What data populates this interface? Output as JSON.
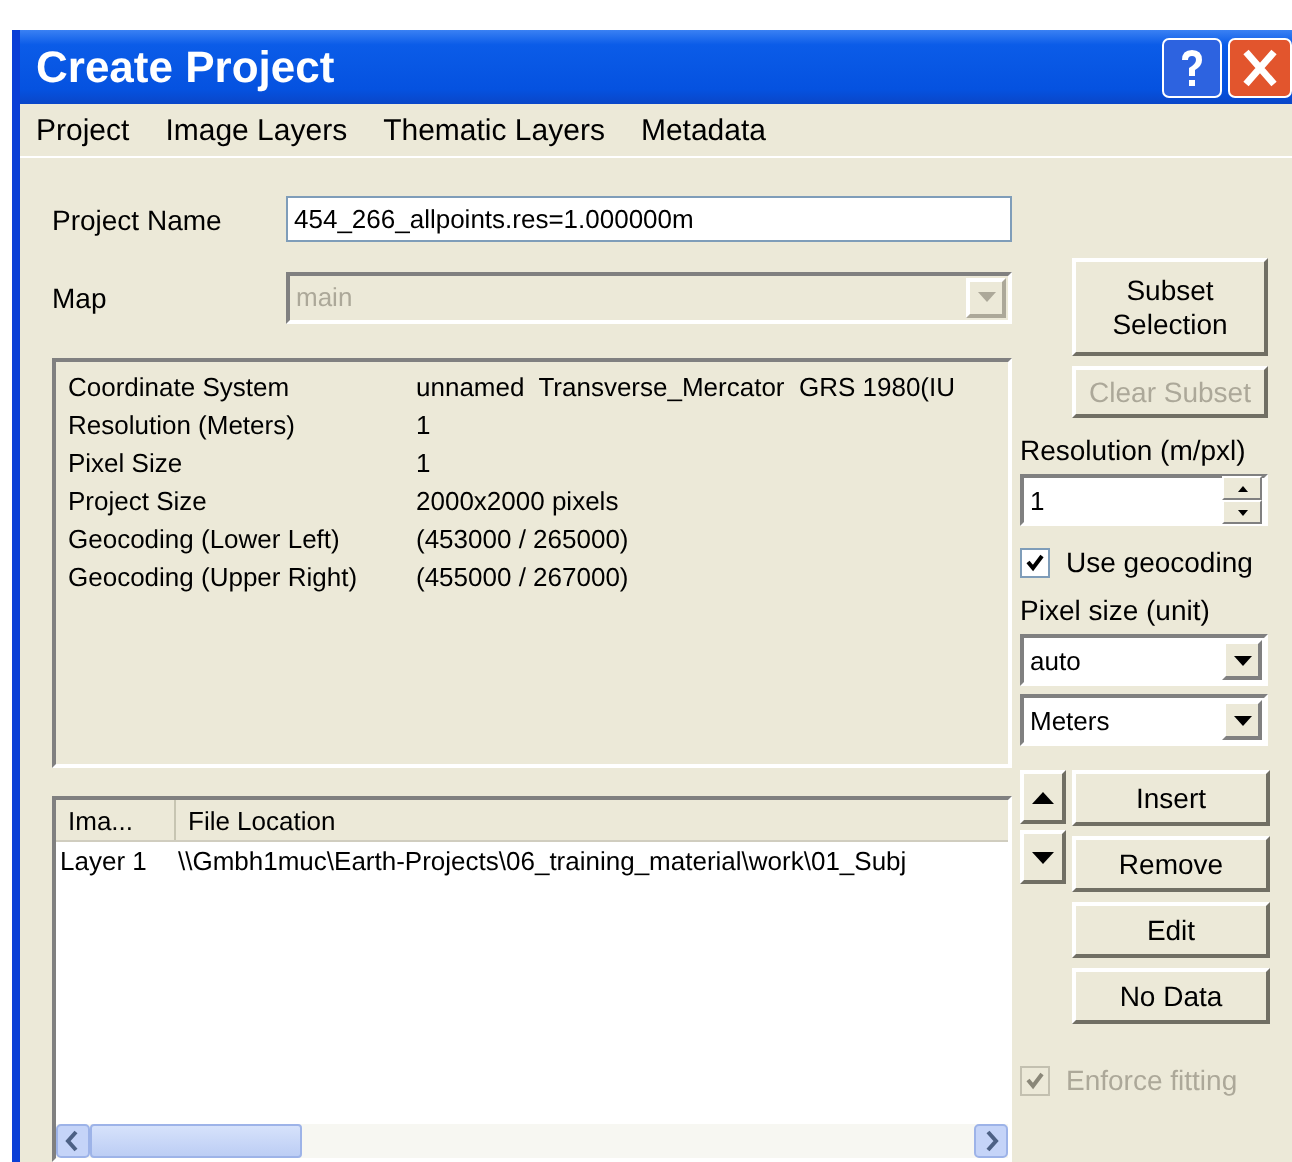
{
  "window": {
    "title": "Create Project"
  },
  "menu": [
    "Project",
    "Image Layers",
    "Thematic Layers",
    "Metadata"
  ],
  "project_name": {
    "label": "Project Name",
    "value": "454_266_allpoints.res=1.000000m"
  },
  "map": {
    "label": "Map",
    "value": "main",
    "disabled": true
  },
  "info": [
    {
      "label": "Coordinate System",
      "value": "unnamed  Transverse_Mercator  GRS 1980(IU"
    },
    {
      "label": "Resolution (Meters)",
      "value": "1"
    },
    {
      "label": "Pixel Size",
      "value": "1"
    },
    {
      "label": "Project Size",
      "value": "2000x2000 pixels"
    },
    {
      "label": "Geocoding (Lower Left)",
      "value": "(453000 / 265000)"
    },
    {
      "label": "Geocoding (Upper Right)",
      "value": "(455000 / 267000)"
    }
  ],
  "layers": {
    "columns": [
      "Ima...",
      "File Location"
    ],
    "rows": [
      [
        "Layer 1",
        "\\\\Gmbh1muc\\Earth-Projects\\06_training_material\\work\\01_Subj"
      ]
    ]
  },
  "subset_button": {
    "label": "Subset Selection",
    "disabled": false
  },
  "clear_subset_button": {
    "label": "Clear Subset",
    "disabled": true
  },
  "resolution": {
    "label": "Resolution (m/pxl)",
    "value": "1"
  },
  "use_geocoding": {
    "label": "Use geocoding",
    "checked": true
  },
  "pixel_size": {
    "label": "Pixel size (unit)",
    "values": [
      "auto",
      "Meters"
    ]
  },
  "layer_buttons": [
    {
      "label": "Insert",
      "disabled": false
    },
    {
      "label": "Remove",
      "disabled": false
    },
    {
      "label": "Edit",
      "disabled": false
    },
    {
      "label": "No Data",
      "disabled": false
    }
  ],
  "enforce_fitting": {
    "label": "Enforce fitting",
    "checked": true,
    "disabled": true
  }
}
